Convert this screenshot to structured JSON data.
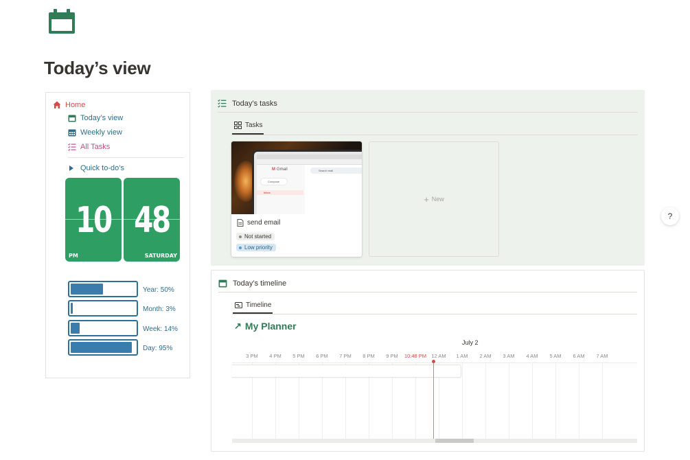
{
  "page": {
    "icon": "calendar-icon",
    "title": "Today’s view"
  },
  "sidebar": {
    "home": {
      "label": "Home",
      "icon": "home-icon",
      "color": "#d44c47"
    },
    "items": [
      {
        "label": "Today’s view",
        "icon": "calendar-icon"
      },
      {
        "label": "Weekly view",
        "icon": "calendar-grid-icon"
      },
      {
        "label": "All Tasks",
        "icon": "checklist-icon"
      }
    ],
    "quick_todos": {
      "label": "Quick to-do’s",
      "icon": "triangle-right-icon"
    }
  },
  "clock": {
    "hours": "10",
    "minutes": "48",
    "meridiem": "PM",
    "day": "SATURDAY",
    "color": "#2f9e62"
  },
  "progress": [
    {
      "label": "Year: 50%",
      "percent": 50
    },
    {
      "label": "Month: 3%",
      "percent": 3
    },
    {
      "label": "Week: 14%",
      "percent": 14
    },
    {
      "label": "Day: 95%",
      "percent": 95
    }
  ],
  "tasks_panel": {
    "title": "Today’s tasks",
    "icon": "checklist-icon",
    "tab": {
      "label": "Tasks",
      "icon": "gallery-icon"
    },
    "cards": [
      {
        "title": "send email",
        "icon": "page-icon",
        "status": "Not started",
        "priority": "Low priority",
        "thumbnail": {
          "app_name": "Gmail",
          "compose": "Compose",
          "inbox": "Inbox",
          "search": "Search mail"
        }
      }
    ],
    "new_label": "New"
  },
  "timeline_panel": {
    "title": "Today’s timeline",
    "icon": "calendar-icon",
    "tab": {
      "label": "Timeline",
      "icon": "timeline-icon"
    },
    "database_link": {
      "label": "My Planner",
      "icon": "arrow-up-right-icon"
    },
    "date": "July 2",
    "hours": [
      "3 PM",
      "4 PM",
      "5 PM",
      "6 PM",
      "7 PM",
      "8 PM",
      "9 PM",
      "10:48 PM",
      "12 AM",
      "1 AM",
      "2 AM",
      "3 AM",
      "4 AM",
      "5 AM",
      "6 AM",
      "7 AM"
    ],
    "current_time": "10:48 PM",
    "accent": "#d44c47"
  },
  "help": {
    "label": "?"
  }
}
